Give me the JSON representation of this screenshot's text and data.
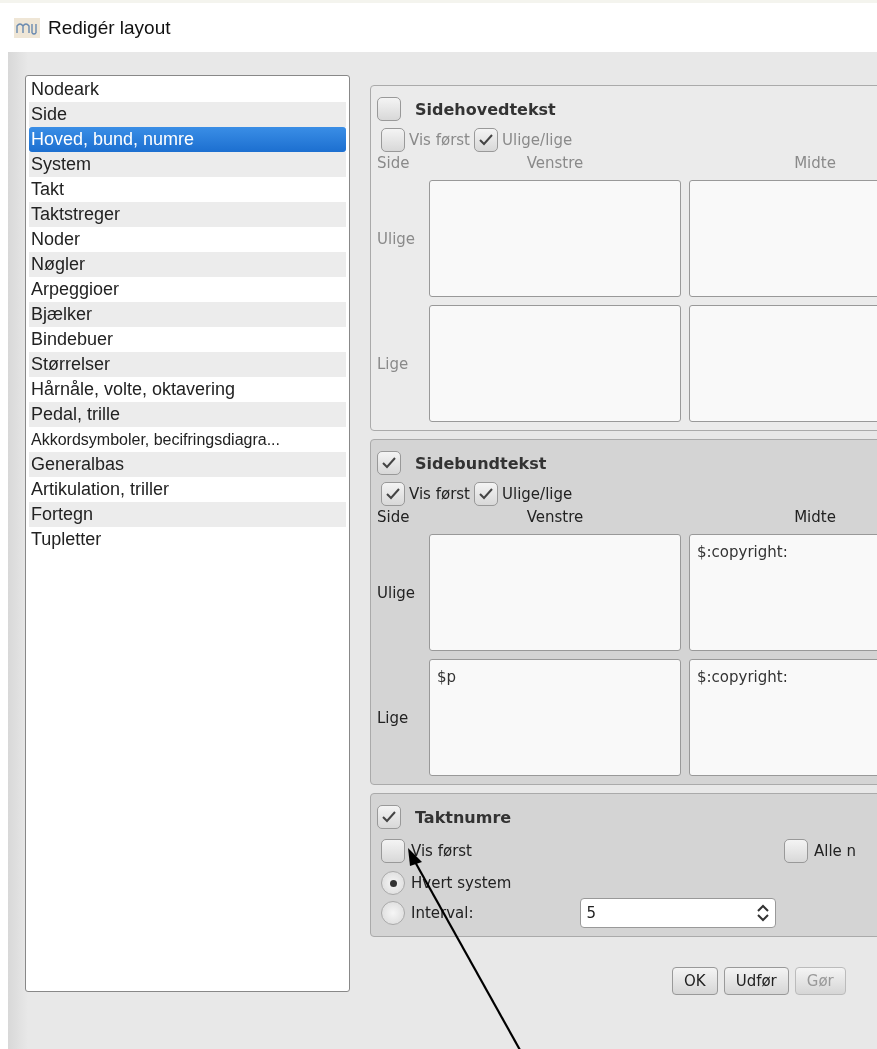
{
  "window": {
    "title": "Redigér layout"
  },
  "sidebar": {
    "items": [
      {
        "label": "Nodeark",
        "selected": false
      },
      {
        "label": "Side",
        "selected": false
      },
      {
        "label": "Hoved, bund, numre",
        "selected": true
      },
      {
        "label": "System",
        "selected": false
      },
      {
        "label": "Takt",
        "selected": false
      },
      {
        "label": "Taktstreger",
        "selected": false
      },
      {
        "label": "Noder",
        "selected": false
      },
      {
        "label": "Nøgler",
        "selected": false
      },
      {
        "label": "Arpeggioer",
        "selected": false
      },
      {
        "label": "Bjælker",
        "selected": false
      },
      {
        "label": "Bindebuer",
        "selected": false
      },
      {
        "label": "Størrelser",
        "selected": false
      },
      {
        "label": "Hårnåle, volte, oktavering",
        "selected": false
      },
      {
        "label": "Pedal, trille",
        "selected": false
      },
      {
        "label": "Akkordsymboler, becifringsdiagra...",
        "selected": false
      },
      {
        "label": "Generalbas",
        "selected": false
      },
      {
        "label": "Artikulation, triller",
        "selected": false
      },
      {
        "label": "Fortegn",
        "selected": false
      },
      {
        "label": "Tupletter",
        "selected": false
      }
    ]
  },
  "sections": [
    {
      "kind": "text_grid",
      "title": "Sidehovedtekst",
      "checked": false,
      "options": [
        {
          "label": "Vis først",
          "checked": false
        },
        {
          "label": "Ulige/lige",
          "checked": true
        }
      ],
      "corner": "Side",
      "columns": [
        "Venstre",
        "Midte"
      ],
      "rows": [
        {
          "label": "Ulige",
          "cells": [
            {},
            {}
          ]
        },
        {
          "label": "Lige",
          "cells": [
            {},
            {}
          ]
        }
      ]
    },
    {
      "kind": "text_grid",
      "title": "Sidebundtekst",
      "checked": true,
      "options": [
        {
          "label": "Vis først",
          "checked": true
        },
        {
          "label": "Ulige/lige",
          "checked": true
        }
      ],
      "corner": "Side",
      "columns": [
        "Venstre",
        "Midte"
      ],
      "rows": [
        {
          "label": "Ulige",
          "cells": [
            {},
            {
              "value": "$:copyright:"
            }
          ]
        },
        {
          "label": "Lige",
          "cells": [
            {
              "value": "$p"
            },
            {
              "value": "$:copyright:"
            }
          ]
        }
      ]
    },
    {
      "kind": "numbers",
      "title": "Taktnumre",
      "checked": true,
      "options": [
        {
          "label": "Vis først",
          "checked": false
        },
        {
          "label": "Alle n",
          "checked": false
        }
      ],
      "radios": [
        {
          "label": "Hvert system",
          "selected": true
        },
        {
          "label": "Interval:",
          "selected": false
        }
      ],
      "interval": "5"
    }
  ],
  "buttons": [
    {
      "label": "OK",
      "disabled": false
    },
    {
      "label": "Udfør",
      "disabled": false
    },
    {
      "label": "Gør",
      "disabled": true
    }
  ]
}
